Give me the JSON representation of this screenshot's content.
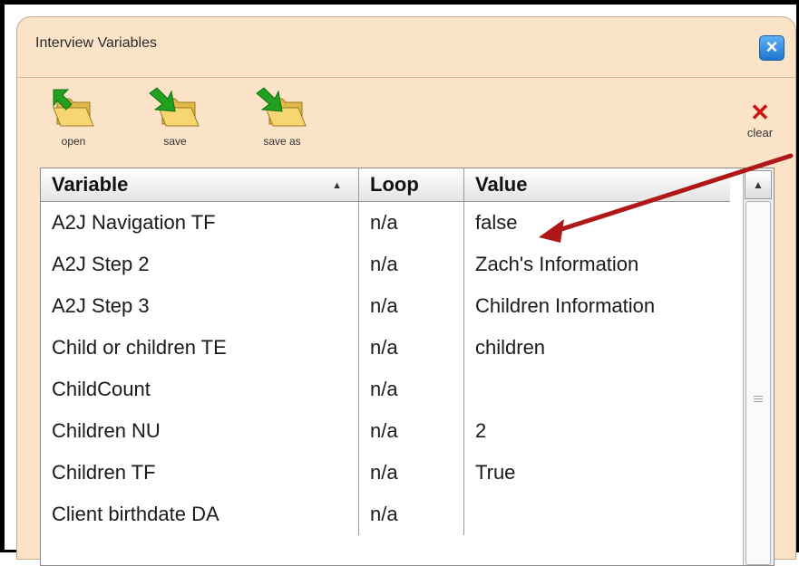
{
  "window": {
    "title": "Interview Variables",
    "close_label": "×"
  },
  "toolbar": {
    "open_label": "open",
    "save_label": "save",
    "save_as_label": "save as",
    "clear_label": "clear"
  },
  "table": {
    "columns": [
      "Variable",
      "Loop",
      "Value"
    ],
    "rows": [
      {
        "variable": "A2J Navigation TF",
        "loop": "n/a",
        "value": "false"
      },
      {
        "variable": "A2J Step 2",
        "loop": "n/a",
        "value": "Zach's Information"
      },
      {
        "variable": "A2J Step 3",
        "loop": "n/a",
        "value": "Children Information"
      },
      {
        "variable": "Child or children TE",
        "loop": "n/a",
        "value": "children"
      },
      {
        "variable": "ChildCount",
        "loop": "n/a",
        "value": ""
      },
      {
        "variable": "Children NU",
        "loop": "n/a",
        "value": "2"
      },
      {
        "variable": "Children TF",
        "loop": "n/a",
        "value": "True"
      },
      {
        "variable": "Client birthdate DA",
        "loop": "n/a",
        "value": ""
      }
    ]
  },
  "colors": {
    "dialog_bg": "#fbe3c8",
    "annotation_arrow": "#b01818",
    "close_button": "#2a86dc"
  }
}
